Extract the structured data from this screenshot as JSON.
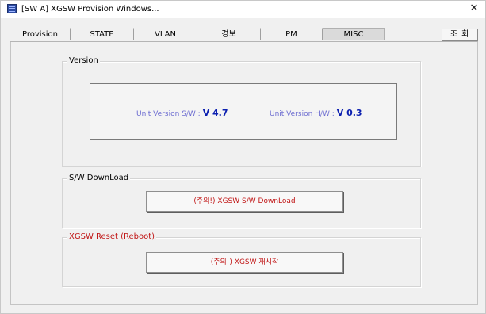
{
  "window": {
    "title": "[SW A] XGSW Provision Windows...",
    "icon": "app-grid-icon",
    "close_glyph": "✕"
  },
  "tabs": [
    {
      "label": "Provision"
    },
    {
      "label": "STATE"
    },
    {
      "label": "VLAN"
    },
    {
      "label": "경보"
    },
    {
      "label": "PM"
    },
    {
      "label": "MISC",
      "active": true
    }
  ],
  "query_button": {
    "label": "조 회"
  },
  "version_group": {
    "title": "Version",
    "sw_label": "Unit Version S/W :",
    "sw_value": "V 4.7",
    "hw_label": "Unit Version H/W :",
    "hw_value": "V 0.3"
  },
  "download_group": {
    "title": "S/W DownLoad",
    "button": "(주의!) XGSW S/W DownLoad"
  },
  "reset_group": {
    "title": "XGSW Reset (Reboot)",
    "button": "(주의!) XGSW 재시작"
  },
  "colors": {
    "accent_red": "#c01414",
    "version_label": "#6b6bd0",
    "version_value": "#0b1fb0"
  }
}
